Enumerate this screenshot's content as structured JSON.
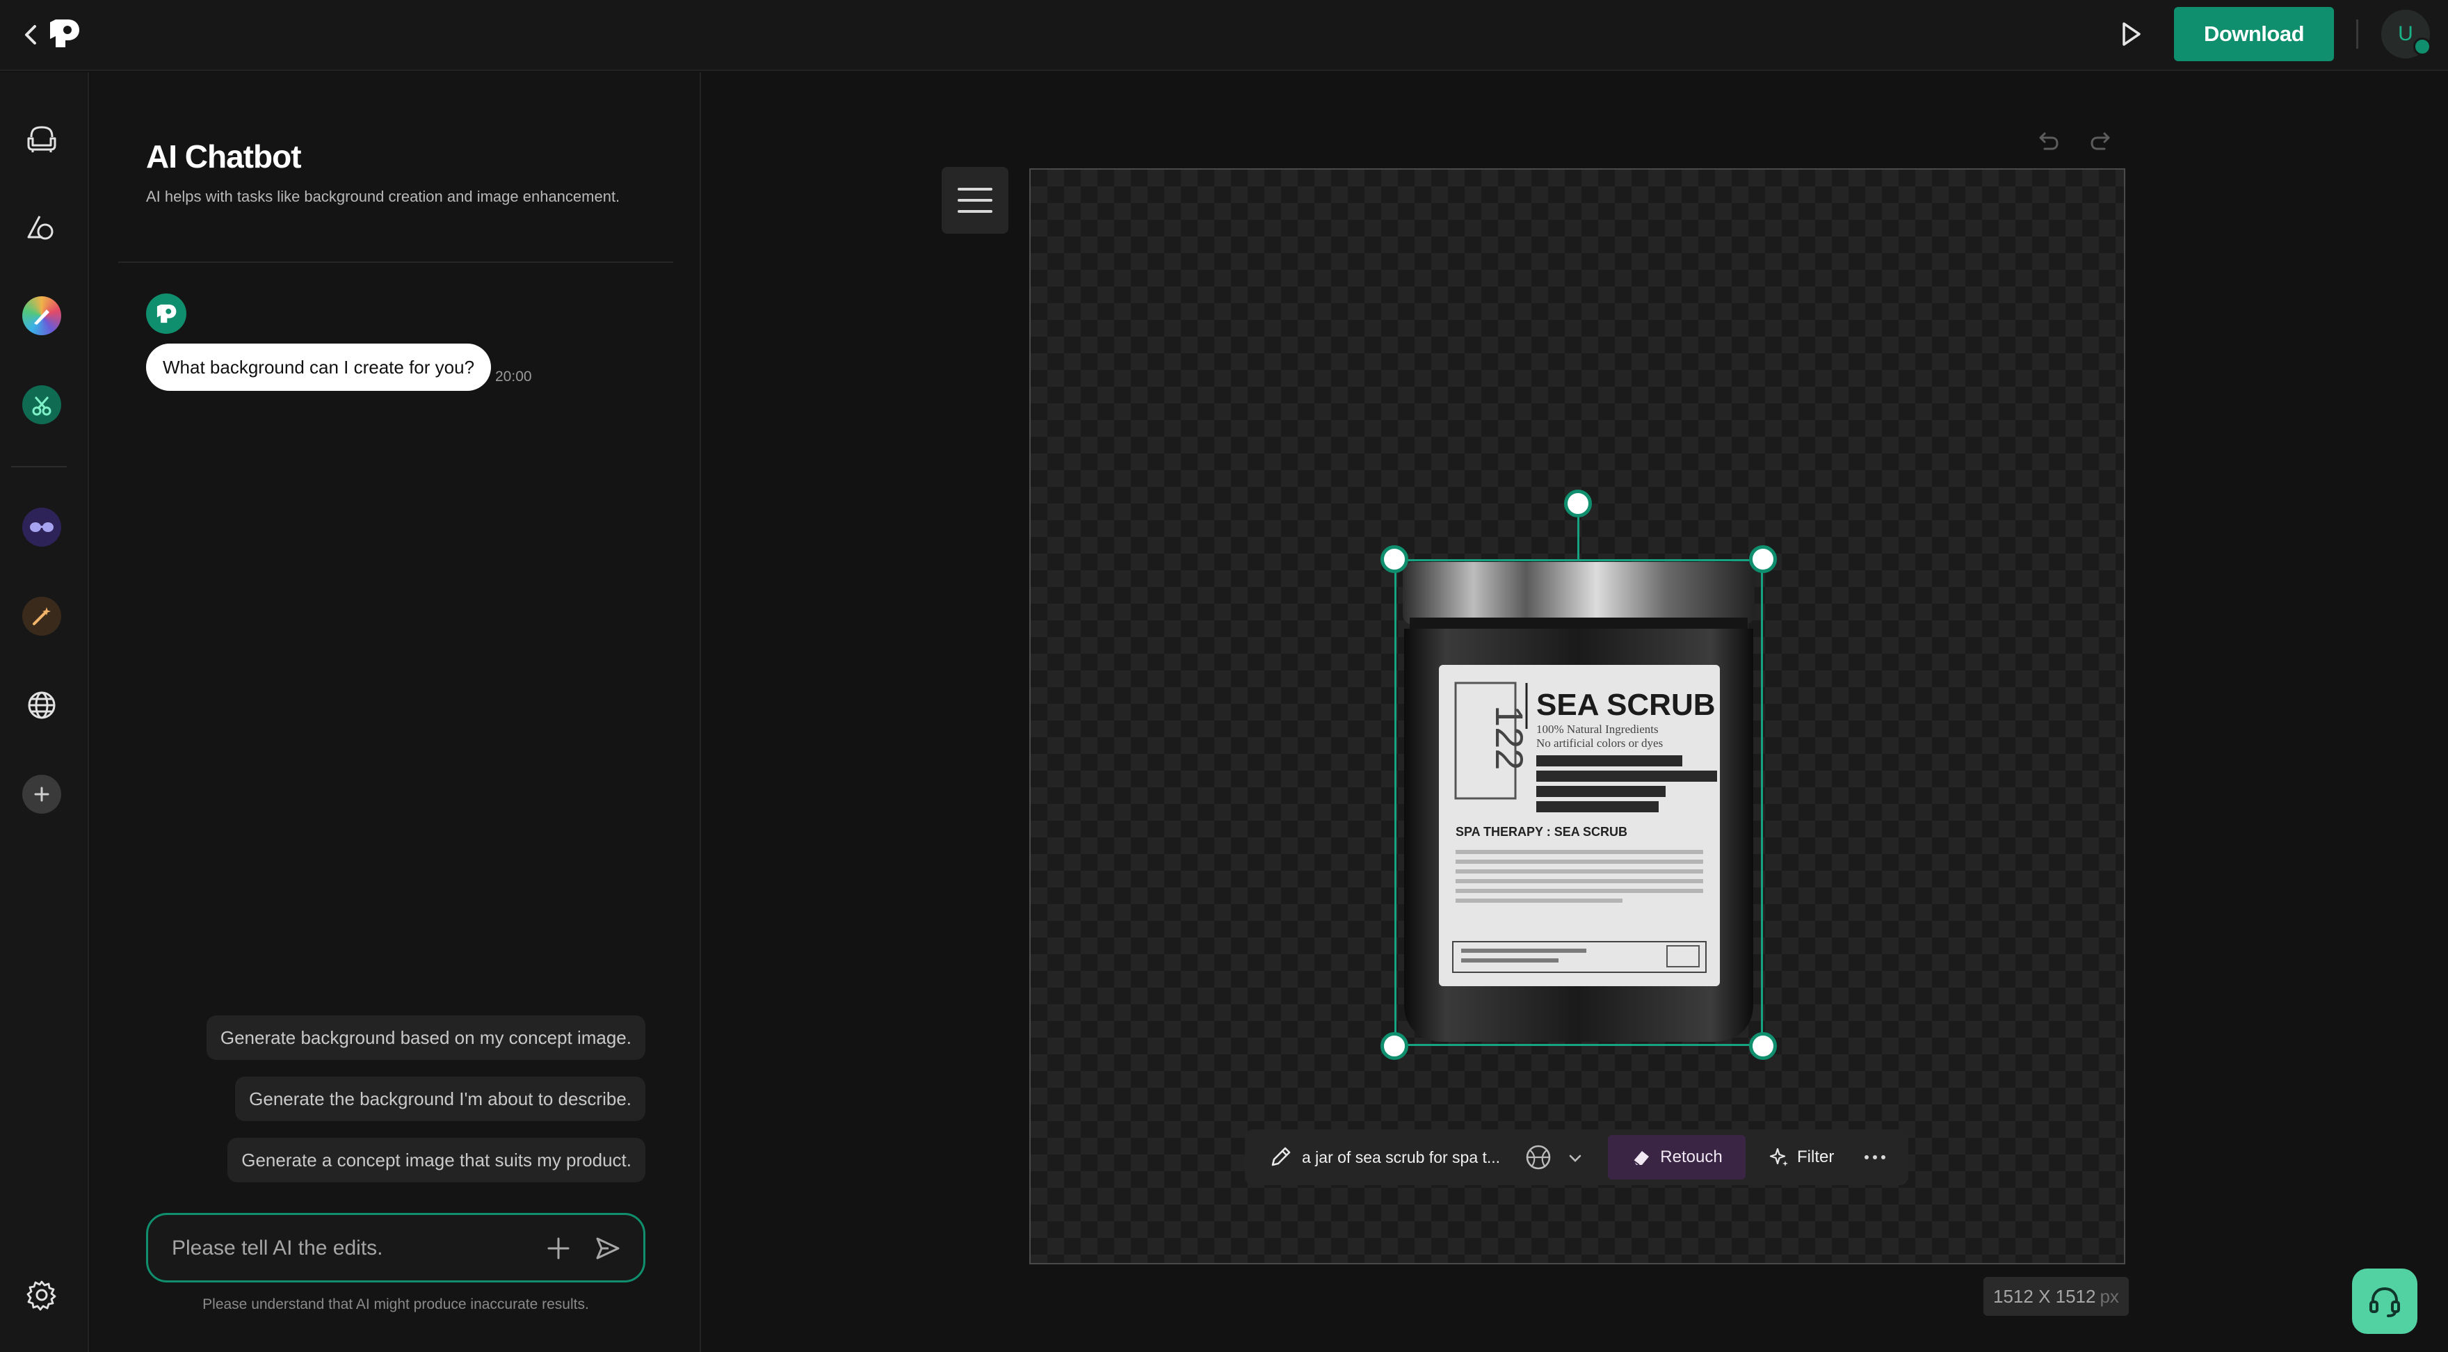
{
  "header": {
    "download_label": "Download",
    "avatar_initial": "U"
  },
  "rail": {
    "items": [
      "chair-icon",
      "shapes-icon",
      "palette-app-icon",
      "scissors-app-icon",
      "glasses-app-icon",
      "magic-wand-app-icon",
      "globe-icon",
      "add-icon"
    ],
    "settings": "gear-icon"
  },
  "chat": {
    "title": "AI Chatbot",
    "subtitle": "AI helps with tasks like background creation and image enhancement.",
    "messages": [
      {
        "from": "bot",
        "text": "What background can I create for you?",
        "time": "20:00"
      }
    ],
    "suggestions": [
      "Generate background based on my concept image.",
      "Generate the background I'm about to describe.",
      "Generate a concept image that suits my product."
    ],
    "input_placeholder": "Please tell AI the edits.",
    "disclaimer": "Please understand that AI might produce inaccurate results."
  },
  "canvas": {
    "product_label": {
      "number": "122",
      "name": "SEA SCRUB",
      "line1": "100% Natural Ingredients",
      "line2": "No artificial colors or dyes",
      "subtitle": "SPA THERAPY : SEA SCRUB"
    },
    "toolbar": {
      "prompt": "a jar of sea scrub for spa t...",
      "retouch_label": "Retouch",
      "filter_label": "Filter"
    },
    "dimensions": "1512 X 1512",
    "dimensions_unit": "px"
  },
  "colors": {
    "accent": "#0f8f6d",
    "retouch_bg": "#3b2545",
    "support_bg": "#52d1a3"
  }
}
